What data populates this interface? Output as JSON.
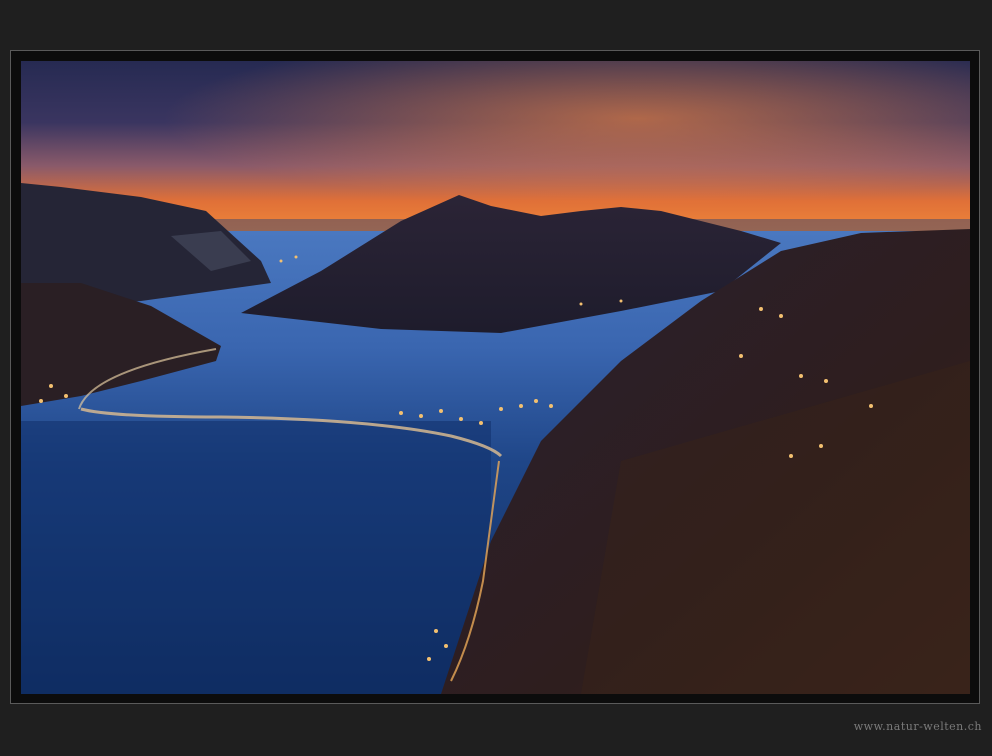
{
  "watermark": "www.natur-welten.ch",
  "colors": {
    "page_background": "#1f1f1f",
    "sky_top": "#262a52",
    "sky_glow": "#f07a34",
    "lake": "#2f5aa5",
    "mountains": "#231c28",
    "town_lights": "#f0b060"
  },
  "photo": {
    "subject": "dusk lake view with mountains and lit causeway"
  }
}
